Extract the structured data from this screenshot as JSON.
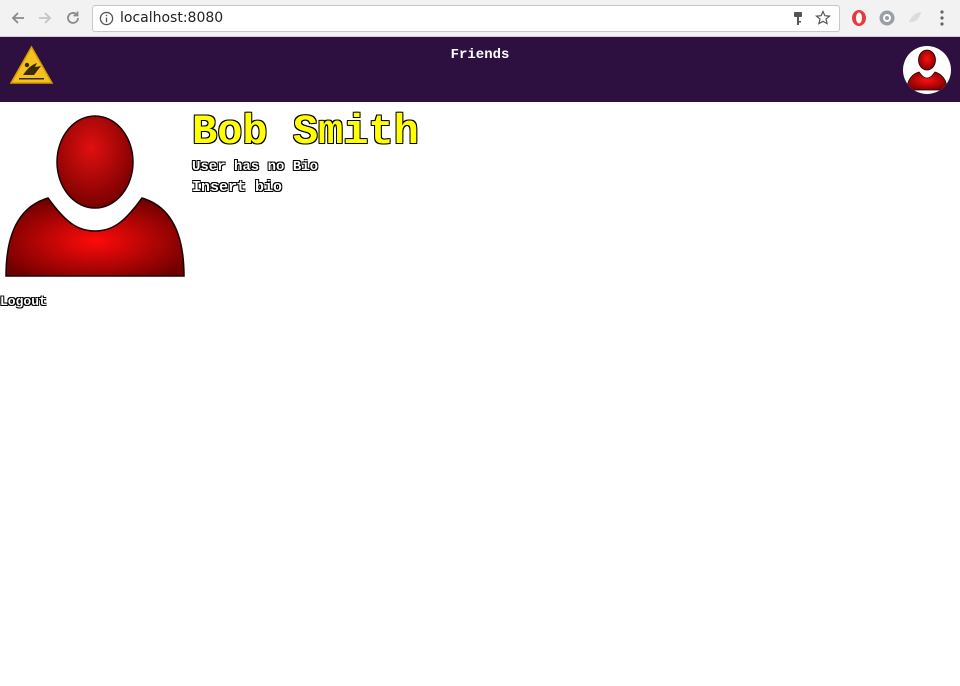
{
  "browser": {
    "url": "localhost:8080",
    "icons": [
      "back-arrow-icon",
      "forward-arrow-icon",
      "reload-icon",
      "info-icon",
      "key-icon",
      "star-icon",
      "opera-extension-icon",
      "extension-icon",
      "extension-icon-2",
      "menu-icon"
    ]
  },
  "header": {
    "nav_title": "Friends",
    "background_color": "#2e1040"
  },
  "profile": {
    "name": "Bob Smith",
    "bio_status": "User has no Bio",
    "insert_bio": "Insert bio",
    "name_color": "#ffff00"
  },
  "actions": {
    "logout": "Logout"
  }
}
